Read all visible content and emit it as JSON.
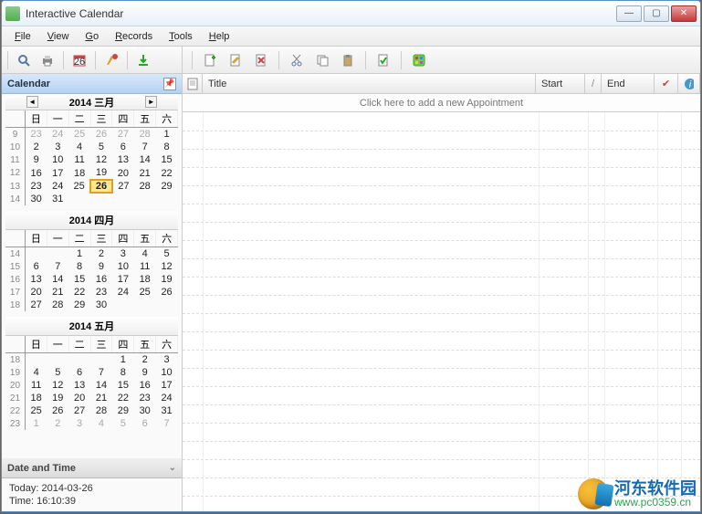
{
  "window": {
    "title": "Interactive Calendar"
  },
  "menu": {
    "file": "File",
    "view": "View",
    "go": "Go",
    "records": "Records",
    "tools": "Tools",
    "help": "Help"
  },
  "sidebar": {
    "calendar_title": "Calendar",
    "datetime_title": "Date and Time",
    "today_label": "Today: 2014-03-26",
    "time_label": "Time: 16:10:39"
  },
  "months": [
    {
      "title": "2014 三月",
      "weekdays": [
        "日",
        "一",
        "二",
        "三",
        "四",
        "五",
        "六"
      ],
      "weeks": [
        {
          "wk": "9",
          "days": [
            {
              "n": 23,
              "dim": true
            },
            {
              "n": 24,
              "dim": true
            },
            {
              "n": 25,
              "dim": true
            },
            {
              "n": 26,
              "dim": true
            },
            {
              "n": 27,
              "dim": true
            },
            {
              "n": 28,
              "dim": true
            },
            {
              "n": 1
            }
          ]
        },
        {
          "wk": "10",
          "days": [
            {
              "n": 2
            },
            {
              "n": 3
            },
            {
              "n": 4
            },
            {
              "n": 5
            },
            {
              "n": 6
            },
            {
              "n": 7
            },
            {
              "n": 8
            }
          ]
        },
        {
          "wk": "11",
          "days": [
            {
              "n": 9
            },
            {
              "n": 10
            },
            {
              "n": 11
            },
            {
              "n": 12
            },
            {
              "n": 13
            },
            {
              "n": 14
            },
            {
              "n": 15
            }
          ]
        },
        {
          "wk": "12",
          "days": [
            {
              "n": 16
            },
            {
              "n": 17
            },
            {
              "n": 18
            },
            {
              "n": 19
            },
            {
              "n": 20
            },
            {
              "n": 21
            },
            {
              "n": 22
            }
          ]
        },
        {
          "wk": "13",
          "days": [
            {
              "n": 23
            },
            {
              "n": 24
            },
            {
              "n": 25
            },
            {
              "n": 26,
              "today": true
            },
            {
              "n": 27
            },
            {
              "n": 28
            },
            {
              "n": 29
            }
          ]
        },
        {
          "wk": "14",
          "days": [
            {
              "n": 30
            },
            {
              "n": 31
            },
            {
              "n": "",
              "dim": true
            },
            {
              "n": "",
              "dim": true
            },
            {
              "n": "",
              "dim": true
            },
            {
              "n": "",
              "dim": true
            },
            {
              "n": "",
              "dim": true
            }
          ]
        }
      ]
    },
    {
      "title": "2014 四月",
      "weekdays": [
        "日",
        "一",
        "二",
        "三",
        "四",
        "五",
        "六"
      ],
      "weeks": [
        {
          "wk": "14",
          "days": [
            {
              "n": "",
              "dim": true
            },
            {
              "n": "",
              "dim": true
            },
            {
              "n": 1
            },
            {
              "n": 2
            },
            {
              "n": 3
            },
            {
              "n": 4
            },
            {
              "n": 5
            }
          ]
        },
        {
          "wk": "15",
          "days": [
            {
              "n": 6
            },
            {
              "n": 7
            },
            {
              "n": 8
            },
            {
              "n": 9
            },
            {
              "n": 10
            },
            {
              "n": 11
            },
            {
              "n": 12
            }
          ]
        },
        {
          "wk": "16",
          "days": [
            {
              "n": 13
            },
            {
              "n": 14
            },
            {
              "n": 15
            },
            {
              "n": 16
            },
            {
              "n": 17
            },
            {
              "n": 18
            },
            {
              "n": 19
            }
          ]
        },
        {
          "wk": "17",
          "days": [
            {
              "n": 20
            },
            {
              "n": 21
            },
            {
              "n": 22
            },
            {
              "n": 23
            },
            {
              "n": 24
            },
            {
              "n": 25
            },
            {
              "n": 26
            }
          ]
        },
        {
          "wk": "18",
          "days": [
            {
              "n": 27
            },
            {
              "n": 28
            },
            {
              "n": 29
            },
            {
              "n": 30
            },
            {
              "n": "",
              "dim": true
            },
            {
              "n": "",
              "dim": true
            },
            {
              "n": "",
              "dim": true
            }
          ]
        }
      ]
    },
    {
      "title": "2014 五月",
      "weekdays": [
        "日",
        "一",
        "二",
        "三",
        "四",
        "五",
        "六"
      ],
      "weeks": [
        {
          "wk": "18",
          "days": [
            {
              "n": "",
              "dim": true
            },
            {
              "n": "",
              "dim": true
            },
            {
              "n": "",
              "dim": true
            },
            {
              "n": "",
              "dim": true
            },
            {
              "n": 1
            },
            {
              "n": 2
            },
            {
              "n": 3
            }
          ]
        },
        {
          "wk": "19",
          "days": [
            {
              "n": 4
            },
            {
              "n": 5
            },
            {
              "n": 6
            },
            {
              "n": 7
            },
            {
              "n": 8
            },
            {
              "n": 9
            },
            {
              "n": 10
            }
          ]
        },
        {
          "wk": "20",
          "days": [
            {
              "n": 11
            },
            {
              "n": 12
            },
            {
              "n": 13
            },
            {
              "n": 14
            },
            {
              "n": 15
            },
            {
              "n": 16
            },
            {
              "n": 17
            }
          ]
        },
        {
          "wk": "21",
          "days": [
            {
              "n": 18
            },
            {
              "n": 19
            },
            {
              "n": 20
            },
            {
              "n": 21
            },
            {
              "n": 22
            },
            {
              "n": 23
            },
            {
              "n": 24
            }
          ]
        },
        {
          "wk": "22",
          "days": [
            {
              "n": 25
            },
            {
              "n": 26
            },
            {
              "n": 27
            },
            {
              "n": 28
            },
            {
              "n": 29
            },
            {
              "n": 30
            },
            {
              "n": 31
            }
          ]
        },
        {
          "wk": "23",
          "days": [
            {
              "n": 1,
              "dim": true
            },
            {
              "n": 2,
              "dim": true
            },
            {
              "n": 3,
              "dim": true
            },
            {
              "n": 4,
              "dim": true
            },
            {
              "n": 5,
              "dim": true
            },
            {
              "n": 6,
              "dim": true
            },
            {
              "n": 7,
              "dim": true
            }
          ]
        }
      ]
    }
  ],
  "list": {
    "col_title": "Title",
    "col_start": "Start",
    "col_slash": "/",
    "col_end": "End",
    "add_hint": "Click here to add a new Appointment"
  },
  "watermark": {
    "cn": "河东软件园",
    "url": "www.pc0359.cn"
  }
}
